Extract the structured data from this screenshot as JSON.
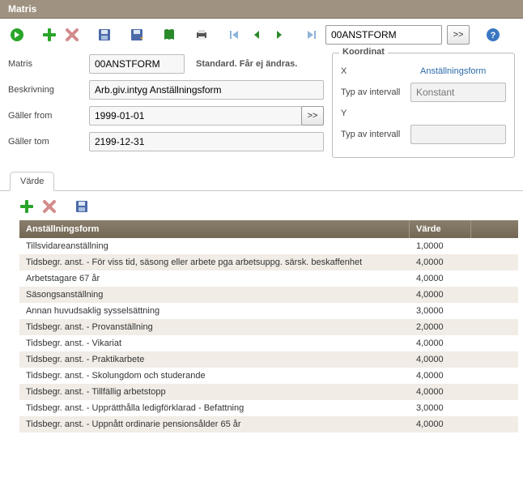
{
  "window": {
    "title": "Matris"
  },
  "toolbar": {
    "nav_value": "00ANSTFORM"
  },
  "form": {
    "labels": {
      "matris": "Matris",
      "beskrivning": "Beskrivning",
      "galler_from": "Gäller from",
      "galler_tom": "Gäller tom"
    },
    "values": {
      "matris": "00ANSTFORM",
      "beskrivning": "Arb.giv.intyg Anställningsform",
      "galler_from": "1999-01-01",
      "galler_tom": "2199-12-31"
    },
    "standard_text": "Standard. Får ej ändras."
  },
  "koordinat": {
    "legend": "Koordinat",
    "labels": {
      "x": "X",
      "typ_x": "Typ av intervall",
      "y": "Y",
      "typ_y": "Typ av intervall"
    },
    "x_link": "Anställningsform",
    "typ_x_value": "Konstant",
    "typ_y_value": ""
  },
  "tab": {
    "label": "Värde"
  },
  "grid": {
    "headers": {
      "col1": "Anställningsform",
      "col2": "Värde"
    },
    "rows": [
      {
        "col1": "Tillsvidareanställning",
        "col2": "1,0000"
      },
      {
        "col1": "Tidsbegr. anst. - För viss tid, säsong eller arbete pga arbetsuppg. särsk. beskaffenhet",
        "col2": "4,0000"
      },
      {
        "col1": "Arbetstagare 67 år",
        "col2": "4,0000"
      },
      {
        "col1": "Säsongsanställning",
        "col2": "4,0000"
      },
      {
        "col1": "Annan huvudsaklig sysselsättning",
        "col2": "3,0000"
      },
      {
        "col1": "Tidsbegr. anst. - Provanställning",
        "col2": "2,0000"
      },
      {
        "col1": "Tidsbegr. anst. - Vikariat",
        "col2": "4,0000"
      },
      {
        "col1": "Tidsbegr. anst. - Praktikarbete",
        "col2": "4,0000"
      },
      {
        "col1": "Tidsbegr. anst. - Skolungdom och studerande",
        "col2": "4,0000"
      },
      {
        "col1": "Tidsbegr. anst. - Tillfällig arbetstopp",
        "col2": "4,0000"
      },
      {
        "col1": "Tidsbegr. anst. - Upprätthålla ledigförklarad - Befattning",
        "col2": "3,0000"
      },
      {
        "col1": "Tidsbegr. anst. - Uppnått ordinarie pensionsålder 65 år",
        "col2": "4,0000"
      }
    ]
  }
}
